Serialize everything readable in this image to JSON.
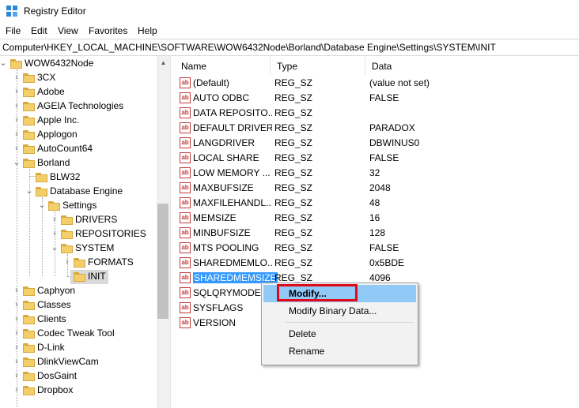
{
  "window": {
    "title": "Registry Editor"
  },
  "menu": {
    "items": [
      "File",
      "Edit",
      "View",
      "Favorites",
      "Help"
    ]
  },
  "address": {
    "path": "Computer\\HKEY_LOCAL_MACHINE\\SOFTWARE\\WOW6432Node\\Borland\\Database Engine\\Settings\\SYSTEM\\INIT"
  },
  "tree": {
    "items": [
      {
        "label": "WOW6432Node",
        "state": "expanded"
      },
      {
        "label": "3CX",
        "state": "collapsed"
      },
      {
        "label": "Adobe",
        "state": "collapsed"
      },
      {
        "label": "AGEIA Technologies",
        "state": "collapsed"
      },
      {
        "label": "Apple Inc.",
        "state": "collapsed"
      },
      {
        "label": "Applogon",
        "state": "collapsed"
      },
      {
        "label": "AutoCount64",
        "state": "collapsed"
      },
      {
        "label": "Borland",
        "state": "expanded"
      },
      {
        "label": "BLW32",
        "state": "leaf"
      },
      {
        "label": "Database Engine",
        "state": "expanded"
      },
      {
        "label": "Settings",
        "state": "expanded"
      },
      {
        "label": "DRIVERS",
        "state": "collapsed"
      },
      {
        "label": "REPOSITORIES",
        "state": "collapsed"
      },
      {
        "label": "SYSTEM",
        "state": "expanded"
      },
      {
        "label": "FORMATS",
        "state": "collapsed"
      },
      {
        "label": "INIT",
        "state": "selected"
      },
      {
        "label": "Caphyon",
        "state": "collapsed"
      },
      {
        "label": "Classes",
        "state": "collapsed"
      },
      {
        "label": "Clients",
        "state": "collapsed"
      },
      {
        "label": "Codec Tweak Tool",
        "state": "collapsed"
      },
      {
        "label": "D-Link",
        "state": "collapsed"
      },
      {
        "label": "DlinkViewCam",
        "state": "collapsed"
      },
      {
        "label": "DosGaint",
        "state": "collapsed"
      },
      {
        "label": "Dropbox",
        "state": "collapsed"
      }
    ]
  },
  "list": {
    "columns": [
      "Name",
      "Type",
      "Data"
    ],
    "rows": [
      {
        "name": "(Default)",
        "type": "REG_SZ",
        "data": "(value not set)"
      },
      {
        "name": "AUTO ODBC",
        "type": "REG_SZ",
        "data": "FALSE"
      },
      {
        "name": "DATA REPOSITO...",
        "type": "REG_SZ",
        "data": ""
      },
      {
        "name": "DEFAULT DRIVER",
        "type": "REG_SZ",
        "data": "PARADOX"
      },
      {
        "name": "LANGDRIVER",
        "type": "REG_SZ",
        "data": "DBWINUS0"
      },
      {
        "name": "LOCAL SHARE",
        "type": "REG_SZ",
        "data": "FALSE"
      },
      {
        "name": "LOW MEMORY ...",
        "type": "REG_SZ",
        "data": "32"
      },
      {
        "name": "MAXBUFSIZE",
        "type": "REG_SZ",
        "data": "2048"
      },
      {
        "name": "MAXFILEHANDL...",
        "type": "REG_SZ",
        "data": "48"
      },
      {
        "name": "MEMSIZE",
        "type": "REG_SZ",
        "data": "16"
      },
      {
        "name": "MINBUFSIZE",
        "type": "REG_SZ",
        "data": "128"
      },
      {
        "name": "MTS POOLING",
        "type": "REG_SZ",
        "data": "FALSE"
      },
      {
        "name": "SHAREDMEMLO...",
        "type": "REG_SZ",
        "data": "0x5BDE"
      },
      {
        "name": "SHAREDMEMSIZE",
        "type": "REG_SZ",
        "data": "4096",
        "selected": true
      },
      {
        "name": "SQLQRYMODE",
        "type": "",
        "data": ""
      },
      {
        "name": "SYSFLAGS",
        "type": "",
        "data": ""
      },
      {
        "name": "VERSION",
        "type": "",
        "data": ""
      }
    ],
    "value_icon": "ab-string-icon"
  },
  "context_menu": {
    "items": [
      "Modify...",
      "Modify Binary Data...",
      "Delete",
      "Rename"
    ],
    "highlighted": "Modify..."
  },
  "colors": {
    "selection": "#3399ff",
    "menu_highlight": "#91c9f7",
    "callout": "#e00a1a",
    "folder": "#f2cf6a"
  }
}
